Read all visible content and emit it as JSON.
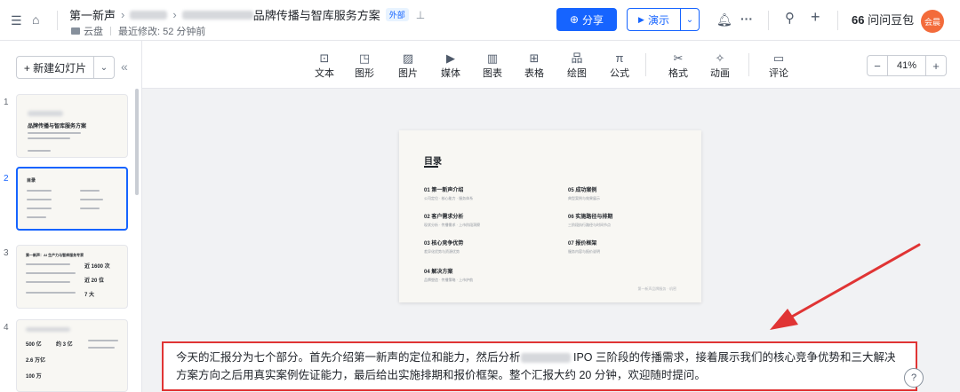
{
  "header": {
    "app_name": "第一新声",
    "title_suffix": "品牌传播与智库服务方案",
    "external_tag": "外部",
    "location": "云盘",
    "last_modified": "最近修改: 52 分钟前",
    "share_label": "分享",
    "present_label": "演示",
    "ai_label": "问问豆包",
    "avatar_text": "会晨"
  },
  "left_panel": {
    "new_slide_label": "+ 新建幻灯片",
    "thumbnails": [
      {
        "number": "1",
        "title": "品牌传播与智库服务方案"
      },
      {
        "number": "2",
        "title": "目录"
      },
      {
        "number": "3",
        "title": "第一新声：AI 生产力与智库服务专家",
        "stat1": "近 1600 次",
        "stat2": "近 20 位",
        "stat3": "7 大"
      },
      {
        "number": "4",
        "stat1": "500 亿",
        "stat2": "约 3 亿",
        "stat3": "2.6 万亿",
        "stat4": "100 万"
      }
    ]
  },
  "toolbar": {
    "items": [
      {
        "label": "文本",
        "icon": "text-icon"
      },
      {
        "label": "图形",
        "icon": "shape-icon"
      },
      {
        "label": "图片",
        "icon": "image-icon"
      },
      {
        "label": "媒体",
        "icon": "media-icon"
      },
      {
        "label": "图表",
        "icon": "chart-icon"
      },
      {
        "label": "表格",
        "icon": "table-icon"
      },
      {
        "label": "绘图",
        "icon": "diagram-icon"
      },
      {
        "label": "公式",
        "icon": "formula-icon"
      },
      {
        "label": "格式",
        "icon": "format-icon"
      },
      {
        "label": "动画",
        "icon": "animation-icon"
      },
      {
        "label": "评论",
        "icon": "comment-icon"
      }
    ],
    "zoom": "41%"
  },
  "slide": {
    "title": "目录",
    "items": [
      {
        "heading": "01 第一新声介绍",
        "sub": "公司定位 · 核心能力 · 服务体系"
      },
      {
        "heading": "02 客户需求分析",
        "sub": "现状分析 · 传播需求 · 上市阶段洞察"
      },
      {
        "heading": "03 核心竞争优势",
        "sub": "差异化优势与资源优势"
      },
      {
        "heading": "04 解决方案",
        "sub": "品牌塑造 · 传播策略 · 上市护航"
      },
      {
        "heading": "05 成功案例",
        "sub": "典型案例与效果展示"
      },
      {
        "heading": "06 实施路径与排期",
        "sub": "三阶段执行路径与时间节点"
      },
      {
        "heading": "07 报价框架",
        "sub": "服务内容与报价说明"
      }
    ],
    "footer": "第一新声品牌服务 · 机密"
  },
  "notes": {
    "part1": "今天的汇报分为七个部分。首先介绍第一新声的定位和能力，然后分析",
    "part2": " IPO 三阶段的传播需求，接着展示我们的核心竞争优势和三大解决方案方向之后用真实案例佐证能力，最后给出实施排期和报价框架。整个汇报大约 20 分钟，欢迎随时提问。"
  },
  "colors": {
    "accent": "#1664ff",
    "annotation": "#e03434",
    "avatar": "#f36b3b"
  }
}
